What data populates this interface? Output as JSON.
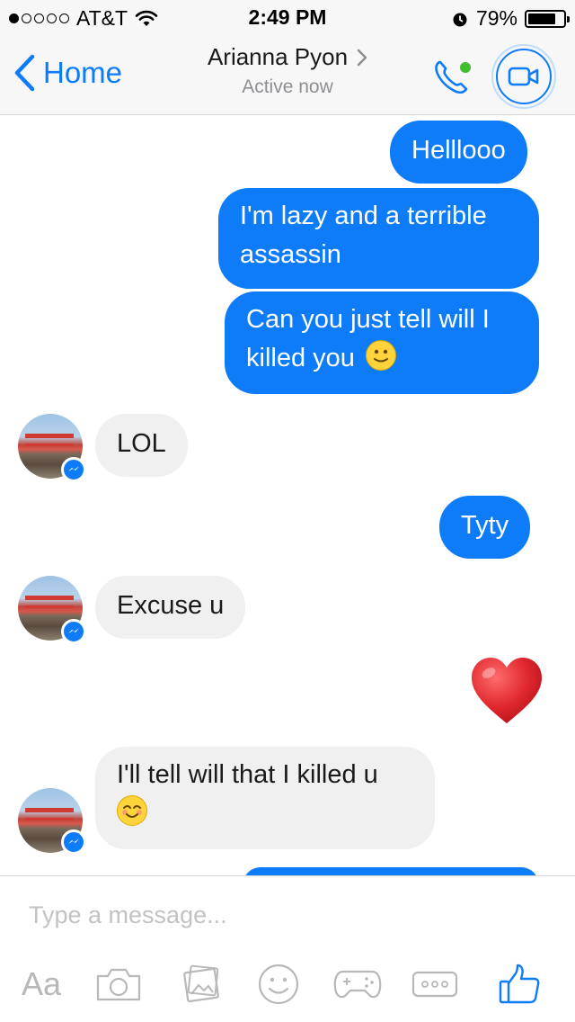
{
  "status_bar": {
    "carrier": "AT&T",
    "signal_dots_filled": 1,
    "signal_dots_total": 5,
    "time": "2:49 PM",
    "battery_percent": "79%",
    "battery_level": 0.79
  },
  "header": {
    "back_label": "Home",
    "contact_name": "Arianna Pyon",
    "contact_status": "Active now",
    "presence_color": "#44bd32",
    "accent_color": "#0e7cf8"
  },
  "messages": [
    {
      "direction": "out",
      "text": "Helllooo"
    },
    {
      "direction": "out",
      "line1": "I'm lazy and a terrible",
      "line2": "assassin"
    },
    {
      "direction": "out",
      "line1": "Can you just tell will I",
      "line2": "killed you",
      "emoji": "slightly-smiling-face"
    },
    {
      "direction": "in",
      "text": "LOL"
    },
    {
      "direction": "out",
      "text": "Tyty"
    },
    {
      "direction": "in",
      "text": "Excuse u"
    },
    {
      "direction": "out",
      "sticker": "red-heart"
    },
    {
      "direction": "in",
      "line1": "I'll tell will that I killed u",
      "emoji": "smiling-face-with-smiling-eyes"
    }
  ],
  "composer": {
    "placeholder": "Type a message...",
    "text_button_label": "Aa",
    "icons": [
      "camera-icon",
      "photo-gallery-icon",
      "emoji-icon",
      "games-icon",
      "more-icon",
      "like-icon"
    ]
  }
}
